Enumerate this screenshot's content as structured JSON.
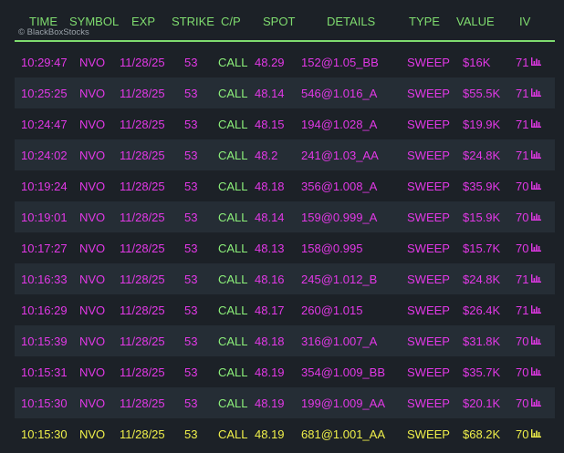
{
  "header": {
    "columns": [
      "TIME",
      "SYMBOL",
      "EXP",
      "STRIKE",
      "C/P",
      "SPOT",
      "DETAILS",
      "TYPE",
      "VALUE",
      "IV"
    ],
    "watermark": "© BlackBoxStocks"
  },
  "colors": {
    "background": "#1c2127",
    "row_alt": "#252d35",
    "header_text": "#7fdc6f",
    "row_text": "#e238e6",
    "call_text": "#8cf07a",
    "highlight_text": "#f0f04a"
  },
  "rows": [
    {
      "time": "10:29:47",
      "symbol": "NVO",
      "exp": "11/28/25",
      "strike": "53",
      "cp": "CALL",
      "spot": "48.29",
      "details": "152@1.05_BB",
      "type": "SWEEP",
      "value": "$16K",
      "iv": "71",
      "icon": "chart-icon"
    },
    {
      "time": "10:25:25",
      "symbol": "NVO",
      "exp": "11/28/25",
      "strike": "53",
      "cp": "CALL",
      "spot": "48.14",
      "details": "546@1.016_A",
      "type": "SWEEP",
      "value": "$55.5K",
      "iv": "71",
      "icon": "chart-icon"
    },
    {
      "time": "10:24:47",
      "symbol": "NVO",
      "exp": "11/28/25",
      "strike": "53",
      "cp": "CALL",
      "spot": "48.15",
      "details": "194@1.028_A",
      "type": "SWEEP",
      "value": "$19.9K",
      "iv": "71",
      "icon": "chart-icon"
    },
    {
      "time": "10:24:02",
      "symbol": "NVO",
      "exp": "11/28/25",
      "strike": "53",
      "cp": "CALL",
      "spot": "48.2",
      "details": "241@1.03_AA",
      "type": "SWEEP",
      "value": "$24.8K",
      "iv": "71",
      "icon": "chart-icon"
    },
    {
      "time": "10:19:24",
      "symbol": "NVO",
      "exp": "11/28/25",
      "strike": "53",
      "cp": "CALL",
      "spot": "48.18",
      "details": "356@1.008_A",
      "type": "SWEEP",
      "value": "$35.9K",
      "iv": "70",
      "icon": "chart-icon"
    },
    {
      "time": "10:19:01",
      "symbol": "NVO",
      "exp": "11/28/25",
      "strike": "53",
      "cp": "CALL",
      "spot": "48.14",
      "details": "159@0.999_A",
      "type": "SWEEP",
      "value": "$15.9K",
      "iv": "70",
      "icon": "chart-icon"
    },
    {
      "time": "10:17:27",
      "symbol": "NVO",
      "exp": "11/28/25",
      "strike": "53",
      "cp": "CALL",
      "spot": "48.13",
      "details": "158@0.995",
      "type": "SWEEP",
      "value": "$15.7K",
      "iv": "70",
      "icon": "chart-icon"
    },
    {
      "time": "10:16:33",
      "symbol": "NVO",
      "exp": "11/28/25",
      "strike": "53",
      "cp": "CALL",
      "spot": "48.16",
      "details": "245@1.012_B",
      "type": "SWEEP",
      "value": "$24.8K",
      "iv": "71",
      "icon": "chart-icon"
    },
    {
      "time": "10:16:29",
      "symbol": "NVO",
      "exp": "11/28/25",
      "strike": "53",
      "cp": "CALL",
      "spot": "48.17",
      "details": "260@1.015",
      "type": "SWEEP",
      "value": "$26.4K",
      "iv": "71",
      "icon": "chart-icon"
    },
    {
      "time": "10:15:39",
      "symbol": "NVO",
      "exp": "11/28/25",
      "strike": "53",
      "cp": "CALL",
      "spot": "48.18",
      "details": "316@1.007_A",
      "type": "SWEEP",
      "value": "$31.8K",
      "iv": "70",
      "icon": "chart-icon"
    },
    {
      "time": "10:15:31",
      "symbol": "NVO",
      "exp": "11/28/25",
      "strike": "53",
      "cp": "CALL",
      "spot": "48.19",
      "details": "354@1.009_BB",
      "type": "SWEEP",
      "value": "$35.7K",
      "iv": "70",
      "icon": "chart-icon"
    },
    {
      "time": "10:15:30",
      "symbol": "NVO",
      "exp": "11/28/25",
      "strike": "53",
      "cp": "CALL",
      "spot": "48.19",
      "details": "199@1.009_AA",
      "type": "SWEEP",
      "value": "$20.1K",
      "iv": "70",
      "icon": "chart-icon"
    },
    {
      "time": "10:15:30",
      "symbol": "NVO",
      "exp": "11/28/25",
      "strike": "53",
      "cp": "CALL",
      "spot": "48.19",
      "details": "681@1.001_AA",
      "type": "SWEEP",
      "value": "$68.2K",
      "iv": "70",
      "icon": "chart-icon",
      "highlight": true
    }
  ]
}
